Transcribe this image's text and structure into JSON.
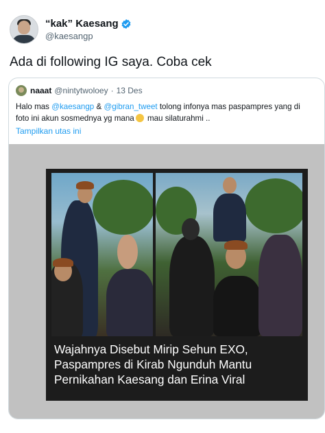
{
  "author": {
    "display_name": "“kak” Kaesang",
    "handle": "@kaesangp",
    "verified_color": "#1d9bf0"
  },
  "tweet_text": "Ada di following IG saya. Coba cek",
  "quoted": {
    "name": "naaat",
    "handle": "@nintytwoloey",
    "separator": "·",
    "date": "13 Des",
    "body_line1_prefix": "Halo mas ",
    "mention1": "@kaesangp",
    "body_line1_mid": " & ",
    "mention2": "@gibran_tweet",
    "body_line1_suffix": " tolong infonya mas paspampres yang di",
    "body_line2_a": "foto ini akun sosmednya yg mana",
    "body_line2_b": " mau silaturahmi ..",
    "emoji_icon": "crying-face-icon",
    "show_thread": "Tampilkan utas ini"
  },
  "media": {
    "caption_lines": [
      "Wajahnya Disebut Mirip Sehun EXO,",
      "Paspampres di Kirab Ngunduh Mantu",
      "Pernikahan Kaesang dan Erina Viral"
    ]
  }
}
